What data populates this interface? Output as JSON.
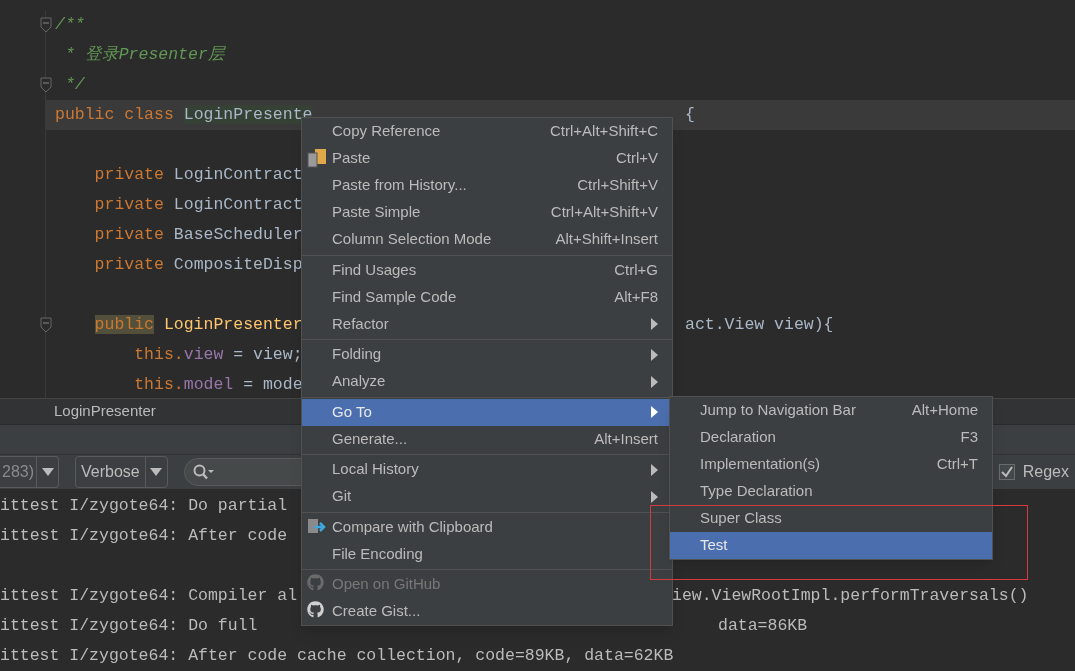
{
  "editor": {
    "lines": [
      {
        "kind": "code",
        "segments": [
          {
            "text": "/**",
            "kind": "comment"
          }
        ],
        "fold": true
      },
      {
        "kind": "code",
        "segments": [
          {
            "text": " * 登录Presenter层",
            "kind": "comment"
          }
        ]
      },
      {
        "kind": "code",
        "segments": [
          {
            "text": " */",
            "kind": "comment"
          }
        ],
        "fold": true
      },
      {
        "kind": "code",
        "segments": [
          {
            "text": "public class ",
            "kind": "keyword"
          },
          {
            "text": "LoginPresente",
            "kind": "highlight"
          }
        ],
        "right": "{",
        "current": true
      },
      {
        "kind": "blank"
      },
      {
        "kind": "code",
        "segments": [
          {
            "text": "    private ",
            "kind": "keyword"
          },
          {
            "text": "LoginContract",
            "kind": "plain"
          }
        ]
      },
      {
        "kind": "code",
        "segments": [
          {
            "text": "    private ",
            "kind": "keyword"
          },
          {
            "text": "LoginContract",
            "kind": "plain"
          }
        ]
      },
      {
        "kind": "code",
        "segments": [
          {
            "text": "    private ",
            "kind": "keyword"
          },
          {
            "text": "BaseScheduler",
            "kind": "plain"
          }
        ]
      },
      {
        "kind": "code",
        "segments": [
          {
            "text": "    private ",
            "kind": "keyword"
          },
          {
            "text": "CompositeDisp",
            "kind": "plain"
          }
        ]
      },
      {
        "kind": "blank"
      },
      {
        "kind": "code",
        "segments": [
          {
            "text": "public",
            "kind": "indented-mark"
          },
          {
            "text": " LoginPresenter",
            "kind": "method"
          }
        ],
        "right": "act.View view){",
        "fold": true
      },
      {
        "kind": "code",
        "segments": [
          {
            "text": "        this.",
            "kind": "keyword"
          },
          {
            "text": "view",
            "kind": "field"
          },
          {
            "text": " = view;",
            "kind": "plain"
          }
        ]
      },
      {
        "kind": "code",
        "segments": [
          {
            "text": "        this.",
            "kind": "keyword"
          },
          {
            "text": "model",
            "kind": "field"
          },
          {
            "text": " = mode",
            "kind": "plain"
          }
        ]
      }
    ]
  },
  "breadcrumb": "LoginPresenter",
  "logcat": {
    "process_filter": "283)",
    "level_filter": "Verbose",
    "regex": {
      "label": "Regex",
      "checked": true
    },
    "lines": [
      {
        "kind": "text",
        "text": "ittest I/zygote64: Do partial"
      },
      {
        "kind": "text",
        "text": "ittest I/zygote64: After code"
      },
      {
        "kind": "blank"
      },
      {
        "kind": "text",
        "text": "ittest I/zygote64: Compiler al",
        "right": "iew.ViewRootImpl.performTraversals()"
      },
      {
        "kind": "text",
        "text": "ittest I/zygote64: Do full",
        "right": "data=86KB"
      },
      {
        "kind": "text",
        "text": "ittest I/zygote64: After code cache collection, code=89KB, data=62KB"
      }
    ]
  },
  "context_menu": {
    "groups": [
      [
        {
          "label": "Copy Reference",
          "shortcut": "Ctrl+Alt+Shift+C",
          "submenu": false,
          "selected": false,
          "disabled": false
        },
        {
          "label": "Paste",
          "shortcut": "Ctrl+V",
          "kind": "clipboard",
          "submenu": false,
          "selected": false,
          "disabled": false
        },
        {
          "label": "Paste from History...",
          "shortcut": "Ctrl+Shift+V",
          "submenu": false,
          "selected": false,
          "disabled": false
        },
        {
          "label": "Paste Simple",
          "shortcut": "Ctrl+Alt+Shift+V",
          "submenu": false,
          "selected": false,
          "disabled": false
        },
        {
          "label": "Column Selection Mode",
          "shortcut": "Alt+Shift+Insert",
          "submenu": false,
          "selected": false,
          "disabled": false
        }
      ],
      [
        {
          "label": "Find Usages",
          "shortcut": "Ctrl+G",
          "submenu": false,
          "selected": false,
          "disabled": false
        },
        {
          "label": "Find Sample Code",
          "shortcut": "Alt+F8",
          "submenu": false,
          "selected": false,
          "disabled": false
        },
        {
          "label": "Refactor",
          "submenu": true,
          "selected": false,
          "disabled": false
        }
      ],
      [
        {
          "label": "Folding",
          "submenu": true,
          "selected": false,
          "disabled": false
        },
        {
          "label": "Analyze",
          "submenu": true,
          "selected": false,
          "disabled": false
        }
      ],
      [
        {
          "label": "Go To",
          "submenu": true,
          "selected": true,
          "disabled": false
        },
        {
          "label": "Generate...",
          "shortcut": "Alt+Insert",
          "submenu": false,
          "selected": false,
          "disabled": false
        }
      ],
      [
        {
          "label": "Local History",
          "submenu": true,
          "selected": false,
          "disabled": false
        },
        {
          "label": "Git",
          "submenu": true,
          "selected": false,
          "disabled": false
        }
      ],
      [
        {
          "label": "Compare with Clipboard",
          "kind": "compare",
          "submenu": false,
          "selected": false,
          "disabled": false
        },
        {
          "label": "File Encoding",
          "submenu": false,
          "selected": false,
          "disabled": false
        }
      ],
      [
        {
          "label": "Open on GitHub",
          "kind": "octocat",
          "submenu": false,
          "selected": false,
          "disabled": true
        },
        {
          "label": "Create Gist...",
          "kind": "octocat",
          "submenu": false,
          "selected": false,
          "disabled": false
        }
      ]
    ]
  },
  "submenu": {
    "items": [
      {
        "label": "Jump to Navigation Bar",
        "shortcut": "Alt+Home",
        "selected": false
      },
      {
        "label": "Declaration",
        "shortcut": "F3",
        "selected": false
      },
      {
        "label": "Implementation(s)",
        "shortcut": "Ctrl+T",
        "selected": false
      },
      {
        "label": "Type Declaration",
        "selected": false
      },
      {
        "label": "Super Class",
        "selected": false
      },
      {
        "label": "Test",
        "selected": true
      }
    ]
  }
}
